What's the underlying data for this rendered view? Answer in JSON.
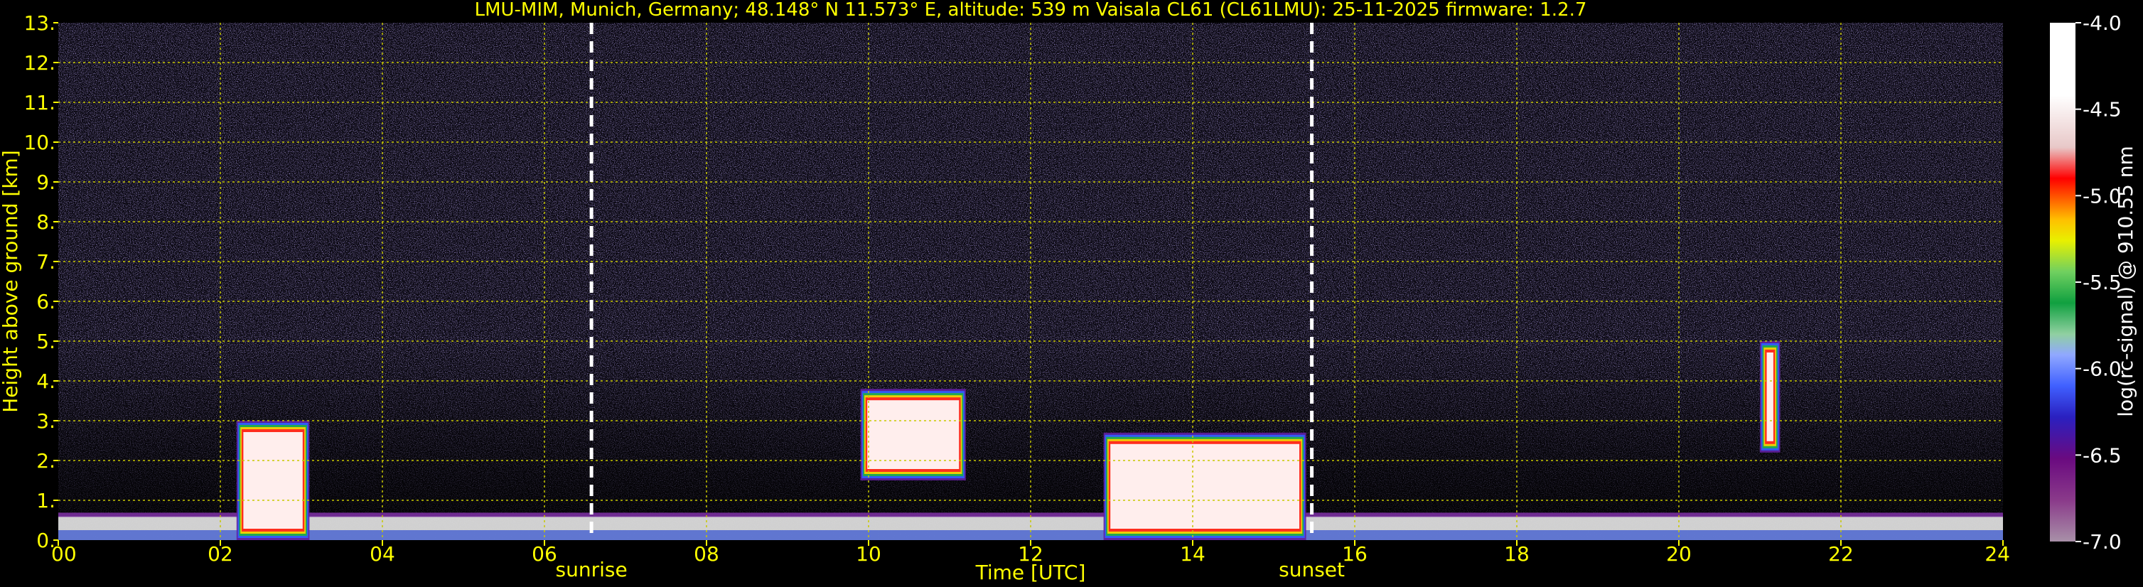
{
  "chart_data": {
    "type": "heatmap",
    "title": "LMU-MIM, Munich, Germany; 48.148° N 11.573° E, altitude: 539 m    Vaisala CL61 (CL61LMU): 25-11-2025    firmware: 1.2.7",
    "xlabel": "Time [UTC]",
    "ylabel": "Height above ground [km]",
    "colorbar_label": "log(rc-signal) @ 910.55 nm",
    "xlim": [
      0,
      24
    ],
    "ylim": [
      0,
      13
    ],
    "x_ticks": [
      "00",
      "02",
      "04",
      "06",
      "08",
      "10",
      "12",
      "14",
      "16",
      "18",
      "20",
      "22",
      "24"
    ],
    "x_tick_values": [
      0,
      2,
      4,
      6,
      8,
      10,
      12,
      14,
      16,
      18,
      20,
      22,
      24
    ],
    "y_ticks": [
      "0.",
      "1.",
      "2.",
      "3.",
      "4.",
      "5.",
      "6.",
      "7.",
      "8.",
      "9.",
      "10.",
      "11.",
      "12.",
      "13."
    ],
    "y_tick_values": [
      0,
      1,
      2,
      3,
      4,
      5,
      6,
      7,
      8,
      9,
      10,
      11,
      12,
      13
    ],
    "grid": true,
    "colorbar": {
      "range": [
        -7.0,
        -4.0
      ],
      "ticks": [
        "-4.0",
        "-4.5",
        "-5.0",
        "-5.5",
        "-6.0",
        "-6.5",
        "-7.0"
      ],
      "tick_values": [
        -4.0,
        -4.5,
        -5.0,
        -5.5,
        -6.0,
        -6.5,
        -7.0
      ]
    },
    "vertical_markers": [
      {
        "label": "sunrise",
        "x": 6.58
      },
      {
        "label": "sunset",
        "x": 15.47
      }
    ],
    "features": [
      {
        "description": "boundary layer",
        "x_range": [
          0,
          24
        ],
        "top_km": 0.6
      },
      {
        "description": "aerosol/cloud",
        "x_range": [
          2.2,
          3.1
        ],
        "top_km": 3.0
      },
      {
        "description": "cloud",
        "x_range": [
          9.9,
          11.2
        ],
        "bottom_km": 1.5,
        "top_km": 3.8
      },
      {
        "description": "low cloud",
        "x_range": [
          12.9,
          15.4
        ],
        "top_km": 2.7
      },
      {
        "description": "cloud",
        "x_range": [
          21.0,
          21.25
        ],
        "bottom_km": 2.2,
        "top_km": 5.0
      }
    ]
  },
  "colors": {
    "background": "#000000",
    "text": "#ffff00",
    "grid": "#c8c800",
    "noise": "#3a2a6a",
    "marker": "#ffffff",
    "colorbar_text": "#ffffff"
  }
}
